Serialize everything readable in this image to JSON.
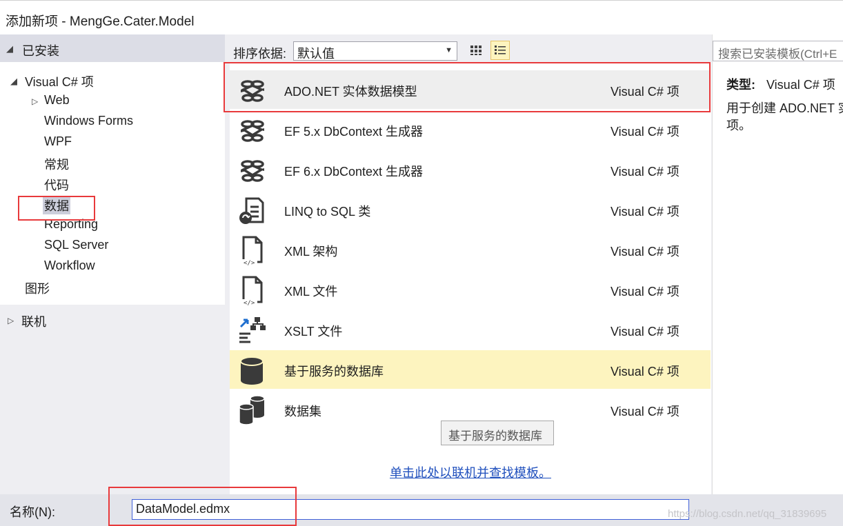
{
  "window": {
    "title": "添加新项 - MengGe.Cater.Model"
  },
  "sidebar": {
    "installed_label": "已安装",
    "tree": [
      {
        "label": "Visual C# 项"
      },
      {
        "label": "Web"
      },
      {
        "label": "Windows Forms"
      },
      {
        "label": "WPF"
      },
      {
        "label": "常规"
      },
      {
        "label": "代码"
      },
      {
        "label": "数据",
        "selected": true
      },
      {
        "label": "Reporting"
      },
      {
        "label": "SQL Server"
      },
      {
        "label": "Workflow"
      },
      {
        "label": "图形"
      }
    ],
    "online_label": "联机"
  },
  "toolbar": {
    "sort_label": "排序依据:",
    "sort_value": "默认值",
    "view_small_icon": "small-icons-view-icon",
    "view_list_icon": "list-view-icon"
  },
  "templates": [
    {
      "name": "ADO.NET 实体数据模型",
      "type": "Visual C# 项",
      "icon": "entity-model-icon",
      "state": "selected"
    },
    {
      "name": "EF 5.x DbContext 生成器",
      "type": "Visual C# 项",
      "icon": "entity-model-icon"
    },
    {
      "name": "EF 6.x DbContext 生成器",
      "type": "Visual C# 项",
      "icon": "entity-model-icon"
    },
    {
      "name": "LINQ to SQL 类",
      "type": "Visual C# 项",
      "icon": "linq-to-sql-icon"
    },
    {
      "name": "XML 架构",
      "type": "Visual C# 项",
      "icon": "xml-file-icon"
    },
    {
      "name": "XML 文件",
      "type": "Visual C# 项",
      "icon": "xml-file-icon"
    },
    {
      "name": "XSLT 文件",
      "type": "Visual C# 项",
      "icon": "xslt-file-icon"
    },
    {
      "name": "基于服务的数据库",
      "type": "Visual C# 项",
      "icon": "database-icon",
      "state": "hover"
    },
    {
      "name": "数据集",
      "type": "Visual C# 项",
      "icon": "dataset-icon"
    }
  ],
  "tooltip": "基于服务的数据库",
  "online_link": "单击此处以联机并查找模板。",
  "details": {
    "search_placeholder": "搜索已安装模板(Ctrl+E",
    "type_label": "类型:",
    "type_value": "Visual C# 项",
    "description_line1": "用于创建 ADO.NET 实",
    "description_line2": "项。"
  },
  "bottom": {
    "name_label": "名称(N):",
    "name_value": "DataModel.edmx",
    "watermark": "https://blog.csdn.net/qq_31839695"
  },
  "colors": {
    "highlight_red": "#e8393b",
    "selection_yellow": "#fdf4bf",
    "link_blue": "#1f4fbd"
  }
}
